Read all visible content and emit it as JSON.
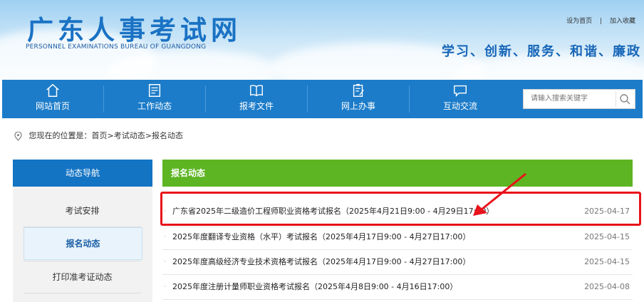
{
  "header": {
    "title": "广东人事考试网",
    "subtitle": "PERSONNEL EXAMINATIONS BUREAU OF GUANGDONG",
    "links": [
      "设为首页",
      "加入收藏"
    ],
    "link_separator": "|",
    "slogan": "学习、创新、服务、和谐、廉政"
  },
  "nav": {
    "items": [
      {
        "label": "网站首页",
        "icon": "home-icon"
      },
      {
        "label": "工作动态",
        "icon": "document-list-icon"
      },
      {
        "label": "报考文件",
        "icon": "open-book-icon"
      },
      {
        "label": "网上办事",
        "icon": "clipboard-edit-icon"
      },
      {
        "label": "互动交流",
        "icon": "chat-bubble-icon"
      }
    ],
    "search_placeholder": "请输入搜索关键字"
  },
  "breadcrumb": "您现在的位置是：首页>考试动态>报名动态",
  "sidebar": {
    "title": "动态导航",
    "items": [
      {
        "label": "考试安排",
        "active": false
      },
      {
        "label": "报名动态",
        "active": true
      },
      {
        "label": "打印准考证动态",
        "active": false
      }
    ]
  },
  "main": {
    "title": "报名动态",
    "bullet": "·",
    "rows": [
      {
        "title": "广东省2025年二级造价工程师职业资格考试报名（2025年4月21日9:00 - 4月29日17:00）",
        "date": "2025-04-17",
        "highlighted": true
      },
      {
        "title": "2025年度翻译专业资格（水平）考试报名（2025年4月17日9:00 - 4月27日17:00）",
        "date": "2025-04-15",
        "highlighted": false
      },
      {
        "title": "2025年度高级经济专业技术资格考试报名（2025年4月17日9:00 - 4月27日17:00）",
        "date": "2025-04-15",
        "highlighted": false
      },
      {
        "title": "2025年度注册计量师职业资格考试报名（2025年4月8日9:00 - 4月16日17:00）",
        "date": "2025-04-08",
        "highlighted": false
      }
    ]
  },
  "colors": {
    "nav_blue": "#1c7cc9",
    "sidebar_blue": "#1374c4",
    "main_green": "#5db523",
    "highlight_red": "#e8131b"
  }
}
